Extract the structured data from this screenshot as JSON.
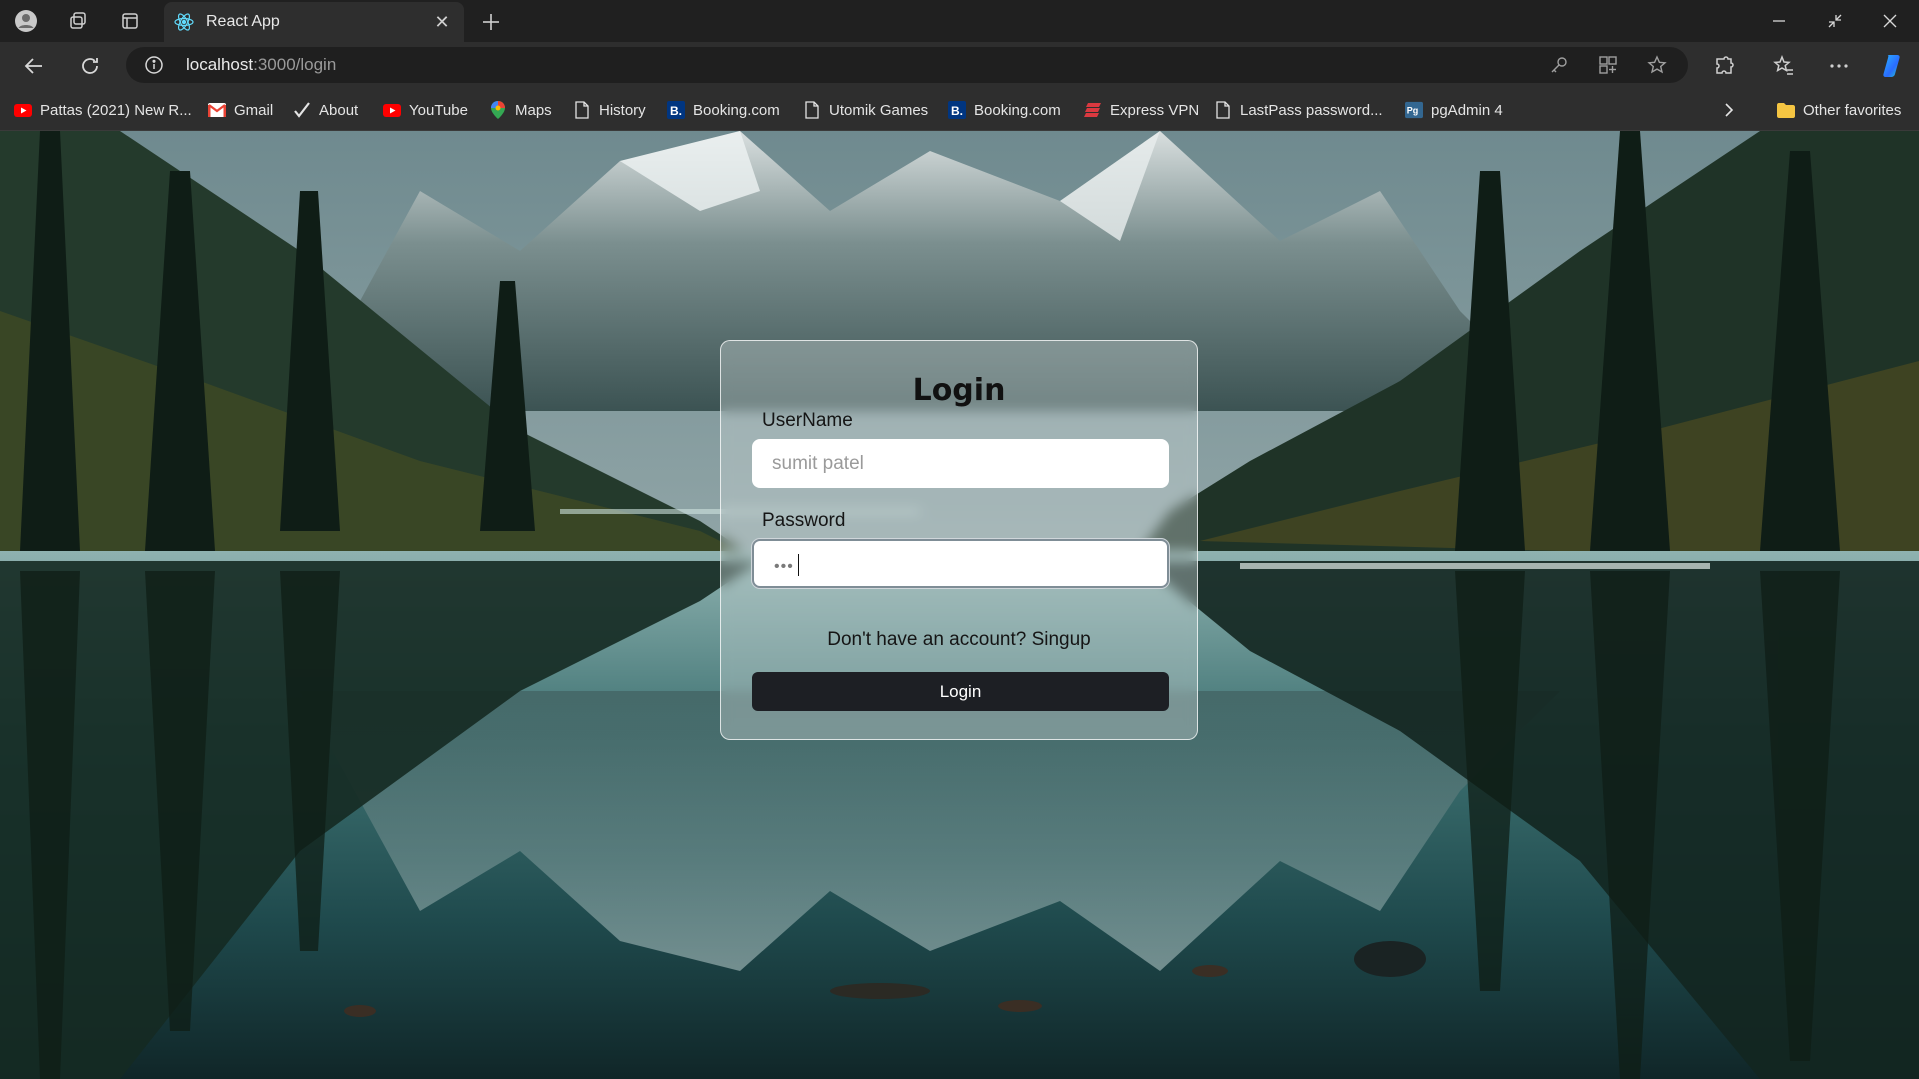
{
  "browser": {
    "tab_title": "React App",
    "url_host": "localhost",
    "url_rest": ":3000/login",
    "favorites": [
      {
        "label": "Pattas (2021) New R...",
        "icon": "youtube-icon"
      },
      {
        "label": "Gmail",
        "icon": "gmail-icon"
      },
      {
        "label": "About",
        "icon": "checkmark-icon"
      },
      {
        "label": "YouTube",
        "icon": "youtube-icon"
      },
      {
        "label": "Maps",
        "icon": "maps-pin-icon"
      },
      {
        "label": "History",
        "icon": "page-icon"
      },
      {
        "label": "Booking.com",
        "icon": "booking-icon"
      },
      {
        "label": "Utomik Games",
        "icon": "page-icon"
      },
      {
        "label": "Booking.com",
        "icon": "booking-icon"
      },
      {
        "label": "Express VPN",
        "icon": "expressvpn-icon"
      },
      {
        "label": "LastPass password...",
        "icon": "page-icon"
      },
      {
        "label": "pgAdmin 4",
        "icon": "pgadmin-icon"
      }
    ],
    "other_favorites": "Other favorites"
  },
  "login": {
    "title": "Login",
    "username_label": "UserName",
    "username_placeholder": "sumit patel",
    "password_label": "Password",
    "password_value": "•••",
    "signup_text": "Don't have an account? Singup",
    "submit_label": "Login"
  },
  "colors": {
    "chrome_dark": "#202020",
    "chrome_mid": "#2e2e2e",
    "button_dark": "#1d1f24",
    "card_border": "#ffffff"
  }
}
